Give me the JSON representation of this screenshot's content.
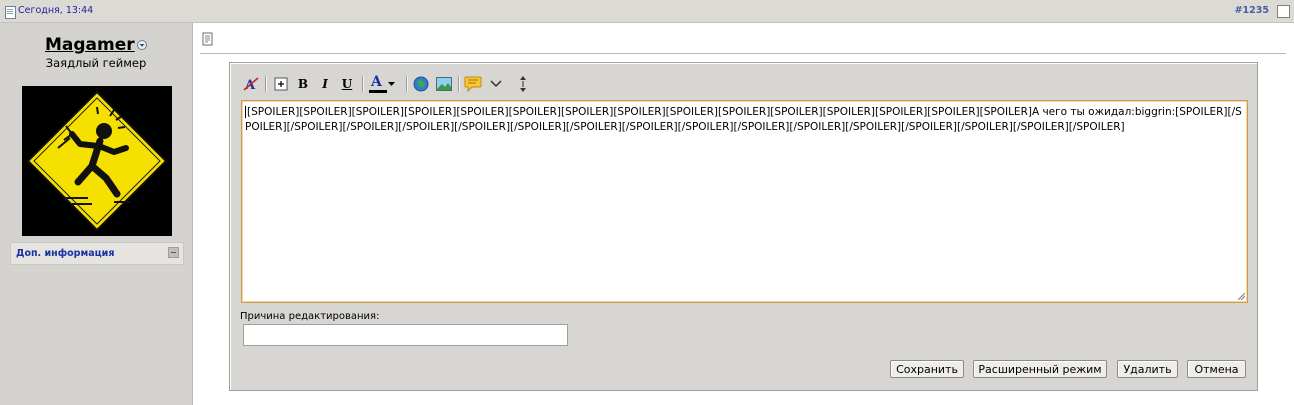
{
  "topbar": {
    "date": "Сегодня, 13:44",
    "post_number": "#1235"
  },
  "user": {
    "name": "Magamer",
    "title": "Заядлый геймер",
    "extra_info_label": "Доп. информация"
  },
  "toolbar": {
    "buttons": [
      {
        "icon": "remove-format-icon"
      },
      {
        "icon": "expand-icon"
      },
      {
        "label": "B",
        "icon": "bold-icon"
      },
      {
        "label": "I",
        "icon": "italic-icon"
      },
      {
        "label": "U",
        "icon": "underline-icon"
      },
      {
        "label": "A",
        "icon": "font-color-icon"
      },
      {
        "icon": "insert-link-icon"
      },
      {
        "icon": "insert-image-icon"
      },
      {
        "icon": "quote-icon"
      },
      {
        "icon": "more-dropdown-icon"
      },
      {
        "icon": "resize-toggle-icon"
      }
    ]
  },
  "editor": {
    "content": "[SPOILER][SPOILER][SPOILER][SPOILER][SPOILER][SPOILER][SPOILER][SPOILER][SPOILER][SPOILER][SPOILER][SPOILER][SPOILER][SPOILER][SPOILER]А чего ты ожидал:biggrin:[SPOILER][/SPOILER][/SPOILER][/SPOILER][/SPOILER][/SPOILER][/SPOILER][/SPOILER][/SPOILER][/SPOILER][/SPOILER][/SPOILER][/SPOILER][/SPOILER][/SPOILER][/SPOILER][/SPOILER]",
    "reason_label": "Причина редактирования:",
    "reason_value": ""
  },
  "buttons": {
    "save": "Сохранить",
    "advanced": "Расширенный режим",
    "delete": "Удалить",
    "cancel": "Отмена"
  },
  "colors": {
    "link_blue": "#1b2fa3",
    "textarea_border": "#d19b4c",
    "frame_bg": "#d7d6d2",
    "sidebar_bg": "#d4d3cf",
    "avatar_sign": "#f5e000"
  }
}
